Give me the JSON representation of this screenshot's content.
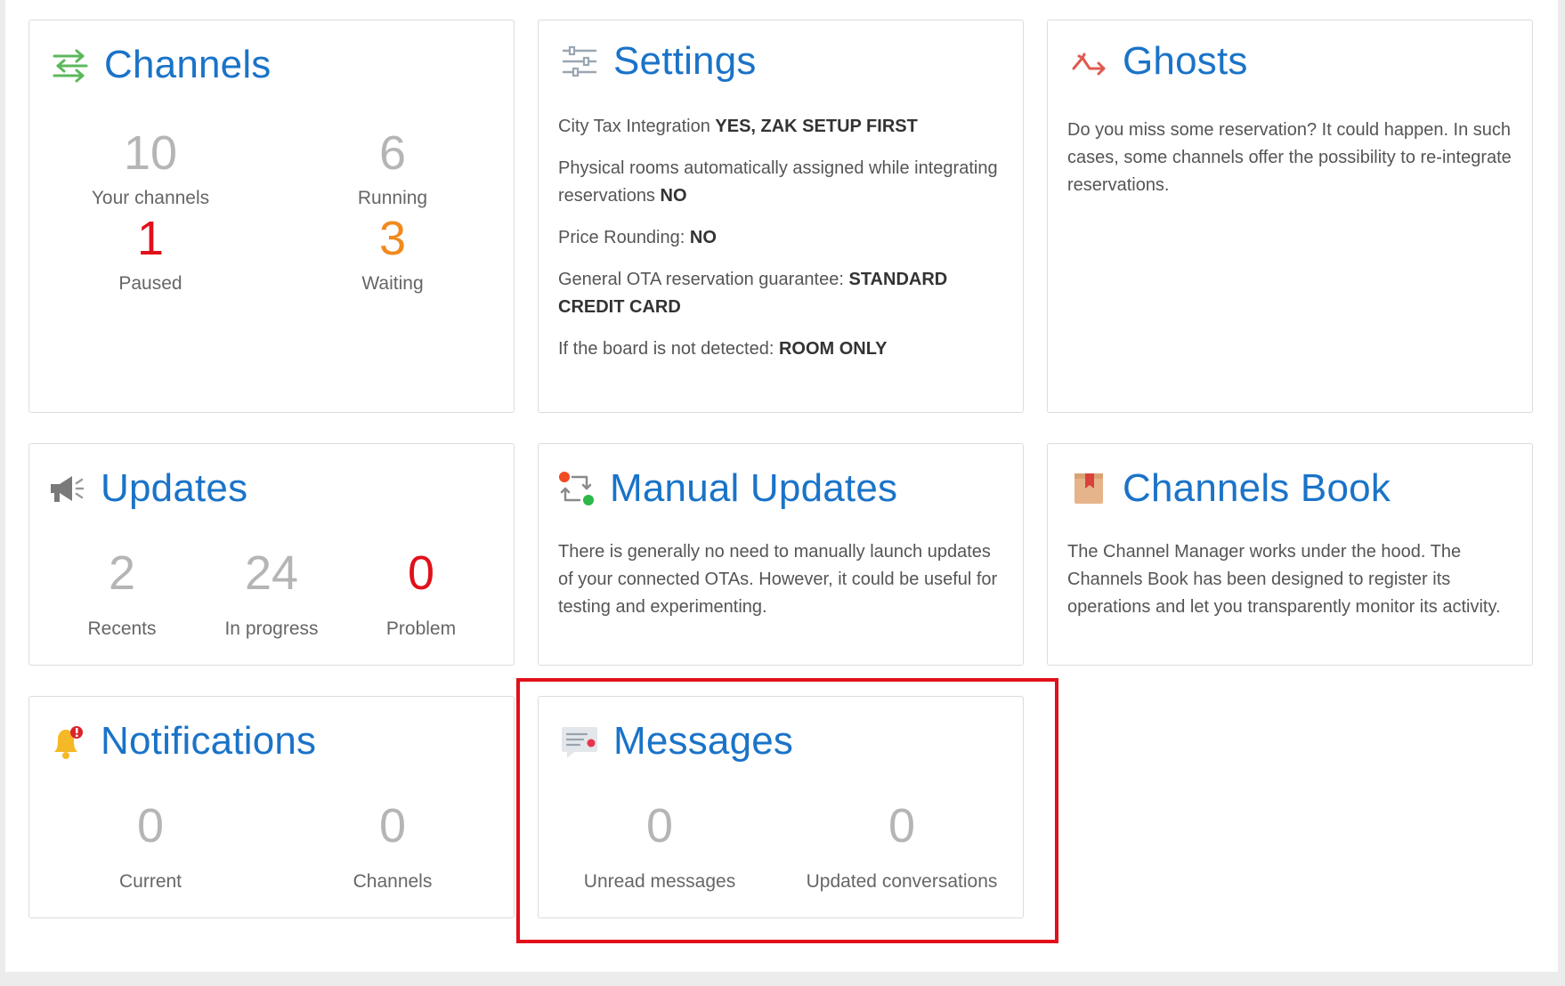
{
  "colors": {
    "title_blue": "#1a73c8",
    "muted_number": "#b5b5b5",
    "red": "#e1101a",
    "orange": "#f08a1c",
    "highlight_box": "#e1101a"
  },
  "channels": {
    "icon": "arrows-transfer-icon",
    "title": "Channels",
    "stats": [
      {
        "value": "10",
        "label": "Your channels"
      },
      {
        "value": "6",
        "label": "Running"
      },
      {
        "value": "1",
        "label": "Paused"
      },
      {
        "value": "3",
        "label": "Waiting"
      }
    ]
  },
  "settings": {
    "icon": "sliders-icon",
    "title": "Settings",
    "lines": [
      {
        "label": "City Tax Integration ",
        "value": "YES, ZAK SETUP FIRST"
      },
      {
        "label": "Physical rooms automatically assigned while integrating reservations ",
        "value": "NO"
      },
      {
        "label": "Price Rounding: ",
        "value": "NO"
      },
      {
        "label": "General OTA reservation guarantee: ",
        "value": "STANDARD CREDIT CARD"
      },
      {
        "label": "If the board is not detected: ",
        "value": "ROOM ONLY"
      }
    ]
  },
  "ghosts": {
    "icon": "ghost-arrow-icon",
    "title": "Ghosts",
    "description": "Do you miss some reservation? It could happen. In such cases, some channels offer the possibility to re-integrate reservations."
  },
  "updates": {
    "icon": "megaphone-icon",
    "title": "Updates",
    "stats": [
      {
        "value": "2",
        "label": "Recents"
      },
      {
        "value": "24",
        "label": "In progress"
      },
      {
        "value": "0",
        "label": "Problem"
      }
    ]
  },
  "manual_updates": {
    "icon": "manual-sync-icon",
    "title": "Manual Updates",
    "description": "There is generally no need to manually launch updates of your connected OTAs. However, it could be useful for testing and experimenting."
  },
  "channels_book": {
    "icon": "bookmark-book-icon",
    "title": "Channels Book",
    "description": "The Channel Manager works under the hood. The Channels Book has been designed to register its operations and let you transparently monitor its activity."
  },
  "notifications": {
    "icon": "bell-icon",
    "title": "Notifications",
    "stats": [
      {
        "value": "0",
        "label": "Current"
      },
      {
        "value": "0",
        "label": "Channels"
      }
    ]
  },
  "messages": {
    "icon": "message-icon",
    "title": "Messages",
    "stats": [
      {
        "value": "0",
        "label": "Unread messages"
      },
      {
        "value": "0",
        "label": "Updated conversations"
      }
    ]
  }
}
